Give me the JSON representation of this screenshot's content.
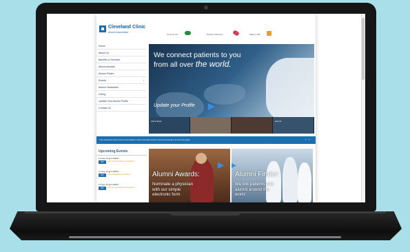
{
  "site": {
    "logo": {
      "name": "Cleveland Clinic",
      "subtitle": "Alumni Association"
    },
    "header_links": [
      {
        "label": "Connect via",
        "icon": "handshake-icon",
        "color": "#2e8b3e"
      },
      {
        "label": "Practice Directory",
        "icon": "pen-icon",
        "color": "#d23c5a"
      },
      {
        "label": "Make a Gift",
        "icon": "gift-icon",
        "color": "#f29b1d"
      }
    ],
    "nav": [
      {
        "label": "Home"
      },
      {
        "label": "About Us"
      },
      {
        "label": "Benefits & Services"
      },
      {
        "label": "Alumni Awards"
      },
      {
        "label": "Alumni Finder"
      },
      {
        "label": "Events",
        "has_submenu": true
      },
      {
        "label": "Alumni Newsletter"
      },
      {
        "label": "Giving"
      },
      {
        "label": "Update Your Alumni Profile"
      },
      {
        "label": "Contact Us"
      }
    ],
    "hero": {
      "headline_line1": "We connect patients to you",
      "headline_line2": "from all over ",
      "headline_emph": "the world.",
      "cta": "Update your Profile",
      "thumbnails": [
        {
          "label": "Clinic News"
        },
        {
          "label": ""
        },
        {
          "label": ""
        },
        {
          "label": "Alumni"
        }
      ]
    },
    "ticker": {
      "text": "The Cleveland Clinic Alumni Association helps Cleveland Clinic trained physicians around the globe",
      "prev_arrow": "‹",
      "next_arrow": "›"
    },
    "events": {
      "title": "Upcoming Events",
      "items": [
        {
          "date": "Fri Sep 15 @ 6:00PM",
          "tag": "ART",
          "name": "Alumni Association Reception"
        },
        {
          "date": "Fri Sep 15 @ 6:00PM",
          "tag": "ART",
          "name": "Alumni Meeting Chicago"
        },
        {
          "date": "Fri Sep 15 @ 6:00PM",
          "tag": "ART",
          "name": "Alumni Association Reception"
        }
      ]
    },
    "promos": [
      {
        "title": "Alumni Awards:",
        "text": "Nominate a physician with our simple electronic form"
      },
      {
        "title": "Alumni Finder:",
        "text": "We link patients and alumni around the world"
      }
    ]
  },
  "colors": {
    "background": "#a9dfe8",
    "brand_blue": "#1a6fb0",
    "nav_text": "#1c3e6e",
    "event_gold": "#d9a21b"
  }
}
